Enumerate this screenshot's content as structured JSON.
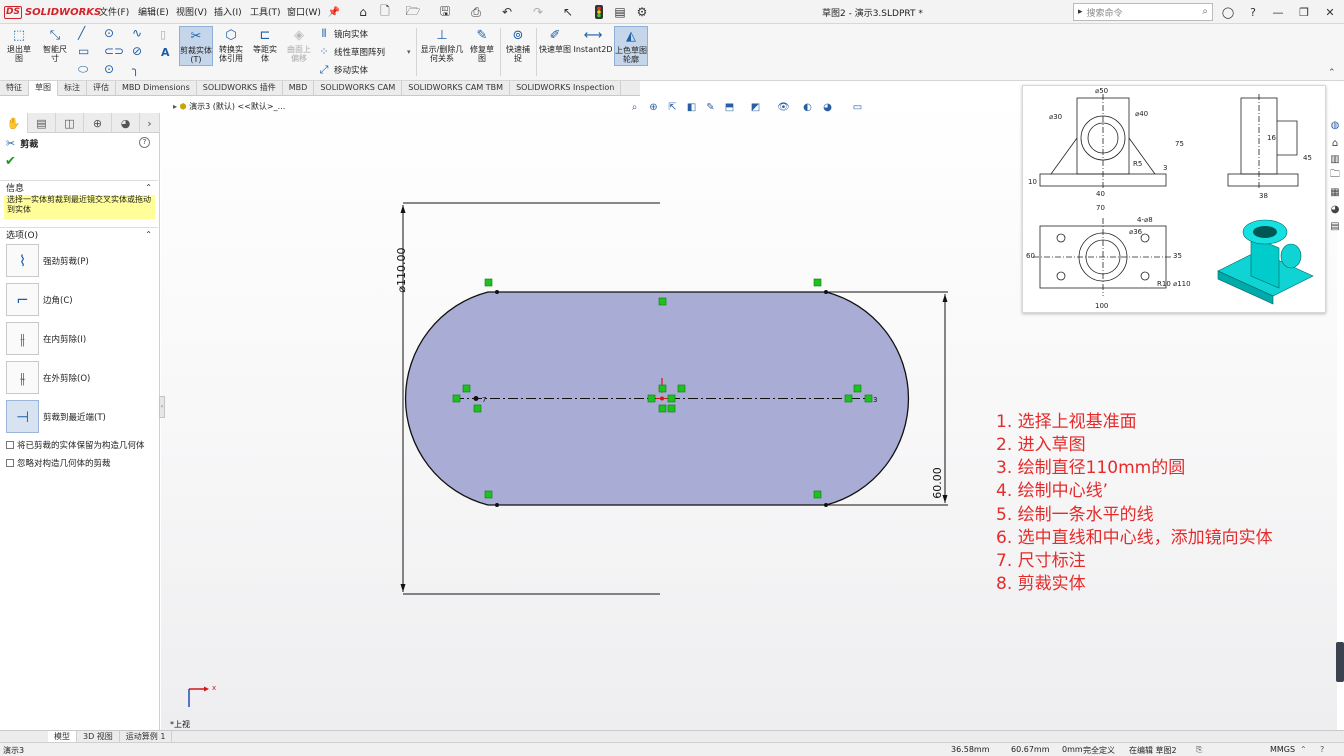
{
  "app": {
    "brand": "SOLIDWORKS",
    "doc_title": "草图2 - 演示3.SLDPRT *"
  },
  "menu": [
    "文件(F)",
    "编辑(E)",
    "视图(V)",
    "插入(I)",
    "工具(T)",
    "窗口(W)"
  ],
  "search": {
    "placeholder": "搜索命令"
  },
  "toolbar": {
    "exit_sketch": "退出草图",
    "smart_dim": "智能尺寸",
    "trim": "剪裁实体(T)",
    "convert": "转换实体引用",
    "offset": "等距实体",
    "surface_offset": "曲面上偏移",
    "mirror": "镜向实体",
    "linear_pattern": "线性草图阵列",
    "move": "移动实体",
    "display_relations": "显示/删除几何关系",
    "repair": "修复草图",
    "quick_snap": "快速捕捉",
    "rapid_sketch": "快速草图",
    "instant2d": "Instant2D",
    "shaded": "上色草图轮廓"
  },
  "tabs": [
    "特征",
    "草图",
    "标注",
    "评估",
    "MBD Dimensions",
    "SOLIDWORKS 插件",
    "MBD",
    "SOLIDWORKS CAM",
    "SOLIDWORKS CAM TBM",
    "SOLIDWORKS Inspection"
  ],
  "active_tab": "草图",
  "panel": {
    "title": "剪裁",
    "info_header": "信息",
    "info_text": "选择一实体剪裁到最近镜交叉实体或拖动到实体",
    "options_header": "选项(O)",
    "options": [
      "强劲剪裁(P)",
      "边角(C)",
      "在内剪除(I)",
      "在外剪除(O)",
      "剪裁到最近端(T)"
    ],
    "checkboxes": [
      "将已剪裁的实体保留为构造几何体",
      "忽略对构造几何体的剪裁"
    ]
  },
  "tree": {
    "label": "演示3 (默认) <<默认>_..."
  },
  "drawing": {
    "dim_diameter": "⌀110.00",
    "dim_height": "60.00",
    "end_labels": [
      "7",
      "3"
    ]
  },
  "reference": {
    "labels": [
      "⌀50",
      "⌀40",
      "⌀30",
      "75",
      "40",
      "10",
      "3",
      "R5",
      "38",
      "45",
      "16",
      "70",
      "⌀36",
      "4-⌀8",
      "60",
      "35",
      "R10",
      "100",
      "⌀110"
    ]
  },
  "steps": [
    "1. 选择上视基准面",
    "2. 进入草图",
    "3. 绘制直径110mm的圆",
    "4. 绘制中心线’",
    "5. 绘制一条水平的线",
    "6. 选中直线和中心线，添加镜向实体",
    "7. 尺寸标注",
    "8. 剪裁实体"
  ],
  "triad": {
    "x": "x",
    "view": "*上视"
  },
  "bottom_tabs": [
    "模型",
    "3D 视图",
    "运动算例 1"
  ],
  "status": {
    "doc": "演示3",
    "x": "36.58mm",
    "y": "60.67mm",
    "z": "0mm",
    "state": "完全定义",
    "editing": "在编辑 草图2",
    "units": "MMGS"
  },
  "colors": {
    "sketch_fill": "#a9acd4",
    "step_red": "#e52b2b",
    "relation_green": "#1ec21e",
    "brand_red": "#d2232a"
  }
}
